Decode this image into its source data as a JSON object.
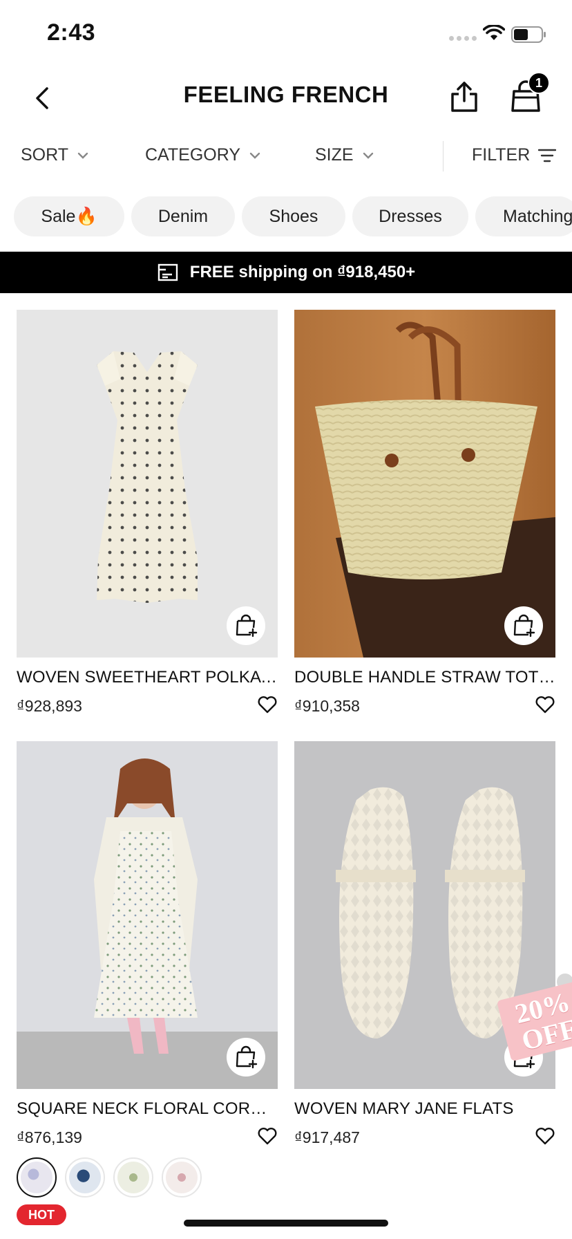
{
  "status_bar": {
    "time": "2:43"
  },
  "header": {
    "title": "FEELING FRENCH",
    "cart_count": "1"
  },
  "filters": {
    "sort": "SORT",
    "category": "CATEGORY",
    "size": "SIZE",
    "filter": "FILTER"
  },
  "chips": [
    "Sale🔥",
    "Denim",
    "Shoes",
    "Dresses",
    "Matching"
  ],
  "banner": {
    "text": "FREE shipping on ₫918,450+"
  },
  "products": [
    {
      "name": "WOVEN SWEETHEART POLKA DOT MAXI DRESS",
      "price": "₫928,893"
    },
    {
      "name": "DOUBLE HANDLE STRAW TOTE BAG",
      "price": "₫910,358"
    },
    {
      "name": "SQUARE NECK FLORAL CORSET MIDI DRESS",
      "price": "₫876,139"
    },
    {
      "name": "WOVEN MARY JANE FLATS",
      "price": "₫917,487"
    }
  ],
  "badges": {
    "hot": "HOT"
  },
  "promo": {
    "line1": "20%",
    "line2": "OFF"
  },
  "colors": {
    "banner_bg": "#000000",
    "chip_bg": "#f2f2f2",
    "hot_badge": "#e3262f",
    "promo": "#f7c2c7"
  }
}
